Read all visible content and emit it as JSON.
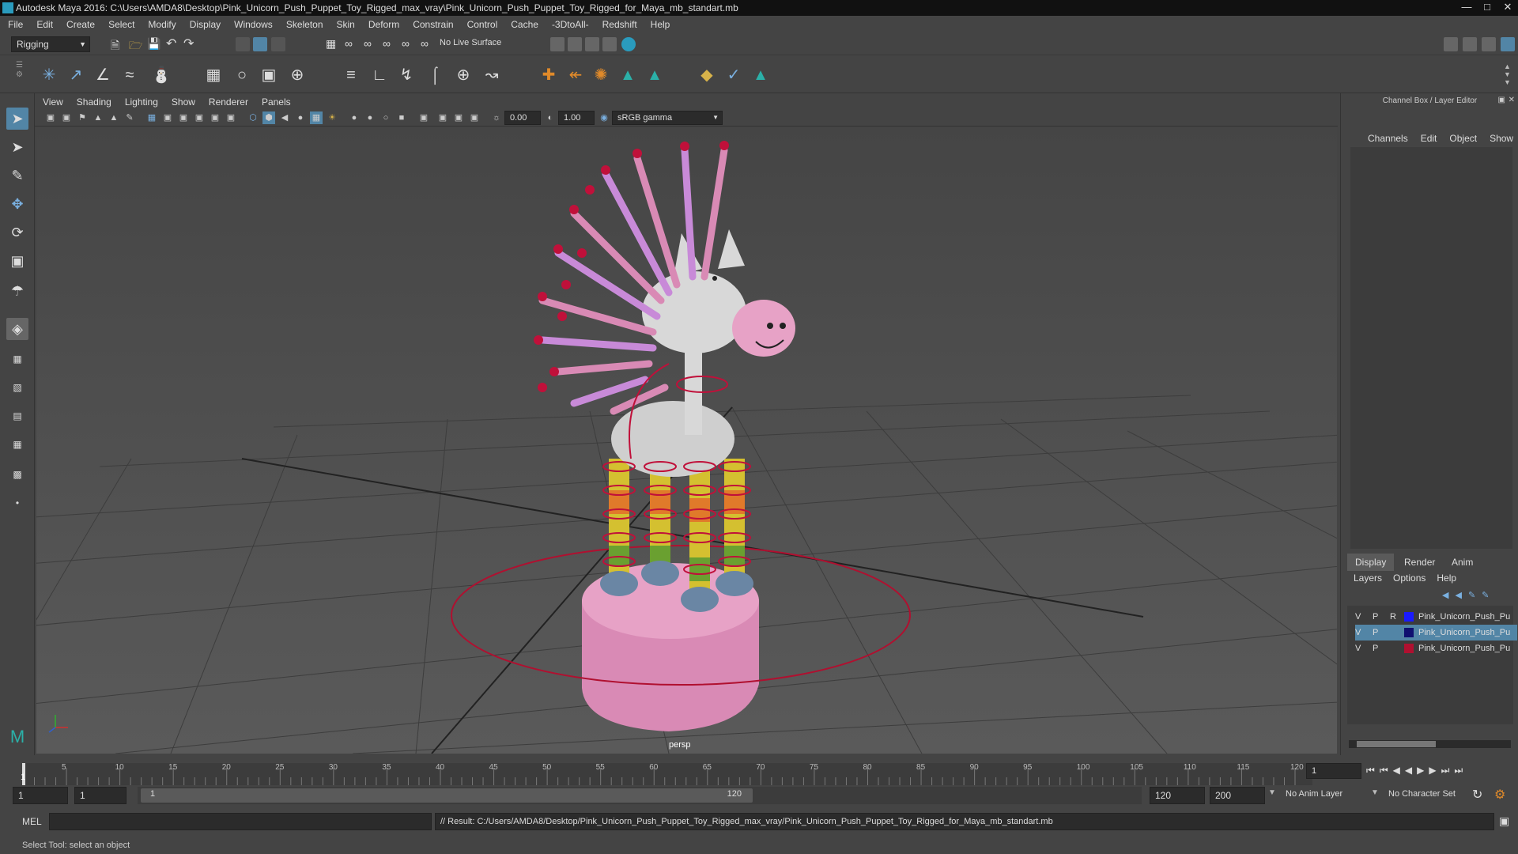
{
  "window": {
    "title": "Autodesk Maya 2016: C:\\Users\\AMDA8\\Desktop\\Pink_Unicorn_Push_Puppet_Toy_Rigged_max_vray\\Pink_Unicorn_Push_Puppet_Toy_Rigged_for_Maya_mb_standart.mb"
  },
  "menubar": [
    "File",
    "Edit",
    "Create",
    "Select",
    "Modify",
    "Display",
    "Windows",
    "Skeleton",
    "Skin",
    "Deform",
    "Constrain",
    "Control",
    "Cache",
    "-3DtoAll-",
    "Redshift",
    "Help"
  ],
  "statusline": {
    "mode": "Rigging",
    "live_surface": "No Live Surface"
  },
  "panel": {
    "menu": [
      "View",
      "Shading",
      "Lighting",
      "Show",
      "Renderer",
      "Panels"
    ],
    "field1": "0.00",
    "field2": "1.00",
    "colorspace": "sRGB gamma",
    "camera_label": "persp"
  },
  "rightpanel": {
    "title": "Channel Box / Layer Editor",
    "channel_menu": [
      "Channels",
      "Edit",
      "Object",
      "Show"
    ],
    "tabs": [
      "Display",
      "Render",
      "Anim"
    ],
    "layer_menu": [
      "Layers",
      "Options",
      "Help"
    ],
    "layers": [
      {
        "v": "V",
        "p": "P",
        "r": "R",
        "color": "#1a1aff",
        "name": "Pink_Unicorn_Push_Pu",
        "selected": false
      },
      {
        "v": "V",
        "p": "P",
        "r": "",
        "color": "#101070",
        "name": "Pink_Unicorn_Push_Pu",
        "selected": true
      },
      {
        "v": "V",
        "p": "P",
        "r": "",
        "color": "#b01030",
        "name": "Pink_Unicorn_Push_Pu",
        "selected": false
      }
    ]
  },
  "timeline": {
    "ticks": [
      "5",
      "10",
      "15",
      "20",
      "25",
      "30",
      "35",
      "40",
      "45",
      "50",
      "55",
      "60",
      "65",
      "70",
      "75",
      "80",
      "85",
      "90",
      "95",
      "100",
      "105",
      "110",
      "115",
      "120"
    ],
    "start_label": "1",
    "current_frame": "1"
  },
  "range": {
    "start": "1",
    "inner_start": "1",
    "slider_start": "1",
    "slider_end": "120",
    "end": "120",
    "anim_end": "200",
    "anim_layer": "No Anim Layer",
    "char_set": "No Character Set"
  },
  "cmd": {
    "lang": "MEL",
    "result": "// Result: C:/Users/AMDA8/Desktop/Pink_Unicorn_Push_Puppet_Toy_Rigged_max_vray/Pink_Unicorn_Push_Puppet_Toy_Rigged_for_Maya_mb_standart.mb"
  },
  "help": "Select Tool: select an object",
  "colors": {
    "accent": "#5285a6",
    "pink": "#d98ab5",
    "red": "#c0103a"
  }
}
